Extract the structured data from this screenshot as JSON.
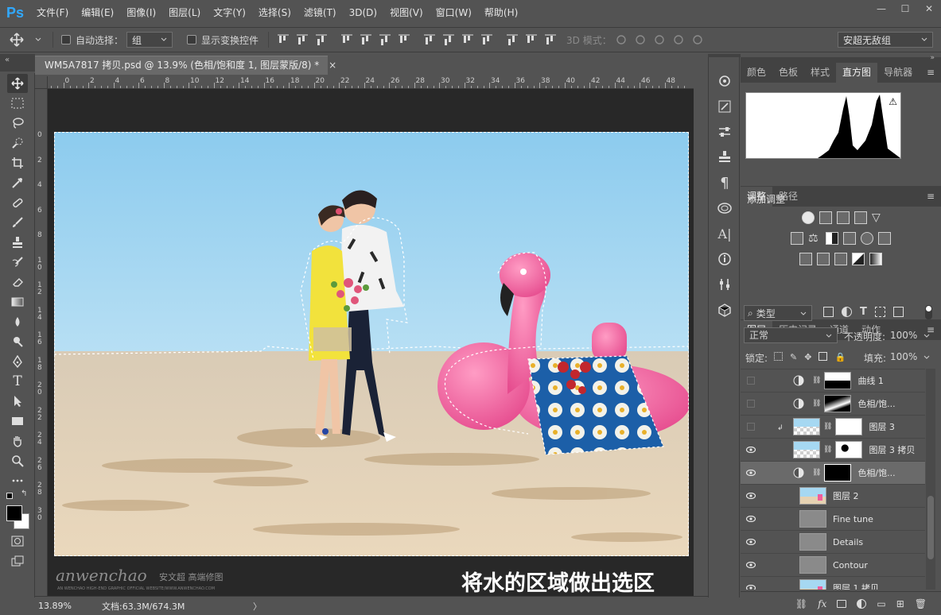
{
  "app": {
    "logo": "Ps"
  },
  "menu": [
    "文件(F)",
    "编辑(E)",
    "图像(I)",
    "图层(L)",
    "文字(Y)",
    "选择(S)",
    "滤镜(T)",
    "3D(D)",
    "视图(V)",
    "窗口(W)",
    "帮助(H)"
  ],
  "window_controls": [
    "—",
    "☐",
    "✕"
  ],
  "options": {
    "auto_select_label": "自动选择：",
    "auto_select_value": "组",
    "transform_label": "显示变换控件",
    "mode_3d": "3D 模式：",
    "workspace": "安超无敌组"
  },
  "document": {
    "tab_title": "WM5A7817 拷贝.psd @ 13.9% (色相/饱和度 1, 图层蒙版/8) *",
    "close": "×"
  },
  "ruler": {
    "top": [
      "2",
      "0",
      "2",
      "4",
      "6",
      "8",
      "10",
      "12",
      "14",
      "16",
      "18",
      "20",
      "22",
      "24",
      "26",
      "28",
      "30",
      "32",
      "34",
      "36",
      "38",
      "40",
      "42",
      "44",
      "46",
      "48"
    ],
    "left": [
      "0",
      "2",
      "4",
      "6",
      "8",
      "1 0",
      "1 2",
      "1 4",
      "1 6",
      "1 8",
      "2 0",
      "2 2",
      "2 4",
      "2 6",
      "2 8",
      "3 0"
    ]
  },
  "watermark": {
    "brand": "anwenchao",
    "cn": "安文超 高端修图",
    "sub": "AN WENCHAO HIGH-END GRAPHIC OFFICIAL WEBSITE/WWW.ANWENCHAO.COM",
    "caption": "将水的区域做出选区"
  },
  "status": {
    "zoom": "13.89%",
    "doc": "文档:63.3M/674.3M",
    "arrow": "〉"
  },
  "panels": {
    "top_tabs": [
      "颜色",
      "色板",
      "样式",
      "直方图",
      "导航器"
    ],
    "top_active": 3,
    "adj_tabs": [
      "调整",
      "路径"
    ],
    "adj_title": "添加调整",
    "layer_tabs": [
      "图层",
      "历史记录",
      "通道",
      "动作"
    ],
    "filter_kind": "类型",
    "blend_mode": "正常",
    "opacity_label": "不透明度:",
    "opacity": "100%",
    "lock_label": "锁定:",
    "fill_label": "填充:",
    "fill": "100%"
  },
  "layers": [
    {
      "name": "曲线 1",
      "visible": false,
      "type": "adj",
      "mask": "curve"
    },
    {
      "name": "色相/饱...",
      "visible": false,
      "type": "adj",
      "mask": "hs"
    },
    {
      "name": "图层 3",
      "visible": false,
      "type": "pix",
      "mask": "white",
      "clip": true
    },
    {
      "name": "图层 3 拷贝",
      "visible": true,
      "type": "pix",
      "mask": "blotch"
    },
    {
      "name": "色相/饱...",
      "visible": true,
      "type": "adj",
      "mask": "black",
      "selected": true
    },
    {
      "name": "图层 2",
      "visible": true,
      "type": "photo"
    },
    {
      "name": "Fine tune",
      "visible": true,
      "type": "group"
    },
    {
      "name": "Details",
      "visible": true,
      "type": "group"
    },
    {
      "name": "Contour",
      "visible": true,
      "type": "group"
    },
    {
      "name": "图层 1 拷贝",
      "visible": true,
      "type": "photo"
    }
  ],
  "colors": {
    "accent": "#31a8ff",
    "sky": "#a6d8f2",
    "sand": "#e6d2b2",
    "flamingo": "#f05d9c"
  }
}
